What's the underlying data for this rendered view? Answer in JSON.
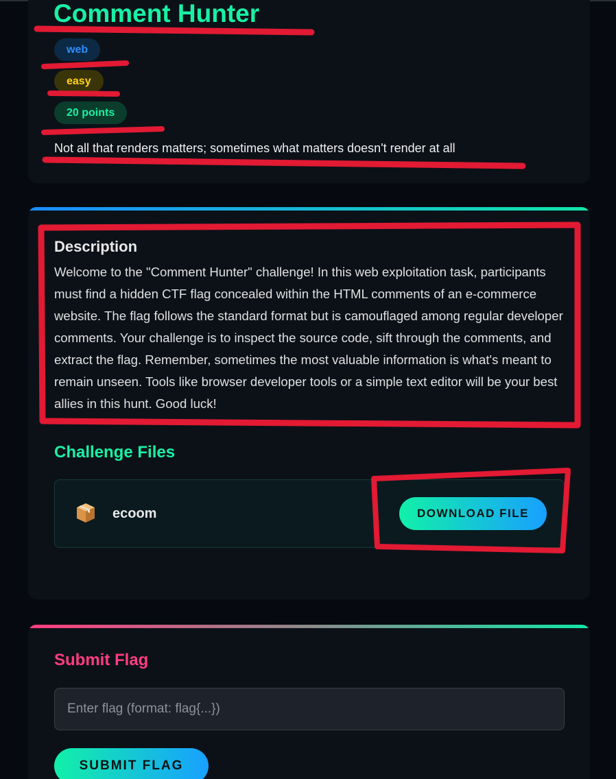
{
  "challenge": {
    "title": "Comment Hunter",
    "category": "web",
    "difficulty": "easy",
    "points": "20 points",
    "tagline": "Not all that renders matters; sometimes what matters doesn't render at all"
  },
  "description": {
    "heading": "Description",
    "text": "Welcome to the \"Comment Hunter\" challenge! In this web exploitation task, participants must find a hidden CTF flag concealed within the HTML comments of an e-commerce website. The flag follows the standard format but is camouflaged among regular developer comments. Your challenge is to inspect the source code, sift through the comments, and extract the flag. Remember, sometimes the most valuable information is what's meant to remain unseen. Tools like browser developer tools or a simple text editor will be your best allies in this hunt. Good luck!"
  },
  "files": {
    "heading": "Challenge Files",
    "items": [
      {
        "name": "ecoom",
        "icon": "package-icon",
        "button_label": "DOWNLOAD FILE"
      }
    ]
  },
  "submit": {
    "heading": "Submit Flag",
    "placeholder": "Enter flag (format: flag{...})",
    "button_label": "SUBMIT FLAG"
  },
  "colors": {
    "accent_green": "#19f0a4",
    "accent_pink": "#ff3d7f",
    "accent_blue": "#18a0ff",
    "annotation_red": "#e21a33"
  }
}
